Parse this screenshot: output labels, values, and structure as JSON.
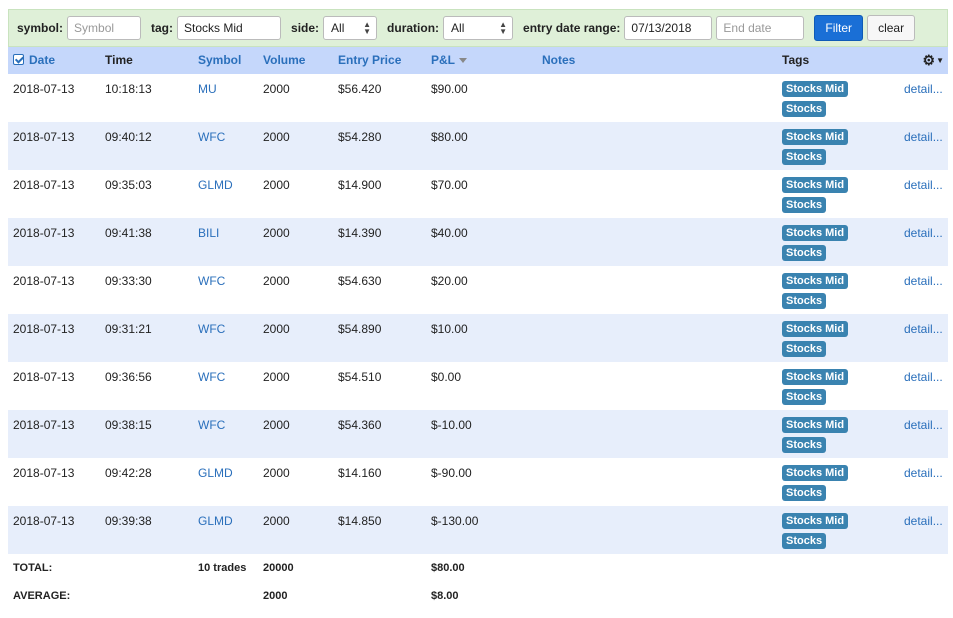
{
  "filters": {
    "symbol_label": "symbol:",
    "symbol_placeholder": "Symbol",
    "tag_label": "tag:",
    "tag_value": "Stocks Mid",
    "side_label": "side:",
    "side_value": "All",
    "duration_label": "duration:",
    "duration_value": "All",
    "entry_date_label": "entry date range:",
    "start_date_value": "07/13/2018",
    "end_date_placeholder": "End date",
    "filter_button": "Filter",
    "clear_button": "clear"
  },
  "columns": {
    "date": "Date",
    "time": "Time",
    "symbol": "Symbol",
    "volume": "Volume",
    "entry_price": "Entry Price",
    "pnl": "P&L",
    "notes": "Notes",
    "tags": "Tags"
  },
  "rows": [
    {
      "date": "2018-07-13",
      "time": "10:18:13",
      "symbol": "MU",
      "volume": "2000",
      "entry_price": "$56.420",
      "pnl": "$90.00",
      "tag1": "Stocks Mid",
      "tag2": "Stocks",
      "detail": "detail..."
    },
    {
      "date": "2018-07-13",
      "time": "09:40:12",
      "symbol": "WFC",
      "volume": "2000",
      "entry_price": "$54.280",
      "pnl": "$80.00",
      "tag1": "Stocks Mid",
      "tag2": "Stocks",
      "detail": "detail..."
    },
    {
      "date": "2018-07-13",
      "time": "09:35:03",
      "symbol": "GLMD",
      "volume": "2000",
      "entry_price": "$14.900",
      "pnl": "$70.00",
      "tag1": "Stocks Mid",
      "tag2": "Stocks",
      "detail": "detail..."
    },
    {
      "date": "2018-07-13",
      "time": "09:41:38",
      "symbol": "BILI",
      "volume": "2000",
      "entry_price": "$14.390",
      "pnl": "$40.00",
      "tag1": "Stocks Mid",
      "tag2": "Stocks",
      "detail": "detail..."
    },
    {
      "date": "2018-07-13",
      "time": "09:33:30",
      "symbol": "WFC",
      "volume": "2000",
      "entry_price": "$54.630",
      "pnl": "$20.00",
      "tag1": "Stocks Mid",
      "tag2": "Stocks",
      "detail": "detail..."
    },
    {
      "date": "2018-07-13",
      "time": "09:31:21",
      "symbol": "WFC",
      "volume": "2000",
      "entry_price": "$54.890",
      "pnl": "$10.00",
      "tag1": "Stocks Mid",
      "tag2": "Stocks",
      "detail": "detail..."
    },
    {
      "date": "2018-07-13",
      "time": "09:36:56",
      "symbol": "WFC",
      "volume": "2000",
      "entry_price": "$54.510",
      "pnl": "$0.00",
      "tag1": "Stocks Mid",
      "tag2": "Stocks",
      "detail": "detail..."
    },
    {
      "date": "2018-07-13",
      "time": "09:38:15",
      "symbol": "WFC",
      "volume": "2000",
      "entry_price": "$54.360",
      "pnl": "$-10.00",
      "tag1": "Stocks Mid",
      "tag2": "Stocks",
      "detail": "detail..."
    },
    {
      "date": "2018-07-13",
      "time": "09:42:28",
      "symbol": "GLMD",
      "volume": "2000",
      "entry_price": "$14.160",
      "pnl": "$-90.00",
      "tag1": "Stocks Mid",
      "tag2": "Stocks",
      "detail": "detail..."
    },
    {
      "date": "2018-07-13",
      "time": "09:39:38",
      "symbol": "GLMD",
      "volume": "2000",
      "entry_price": "$14.850",
      "pnl": "$-130.00",
      "tag1": "Stocks Mid",
      "tag2": "Stocks",
      "detail": "detail..."
    }
  ],
  "totals": {
    "label": "TOTAL:",
    "trades": "10 trades",
    "volume": "20000",
    "pnl": "$80.00"
  },
  "average": {
    "label": "AVERAGE:",
    "volume": "2000",
    "pnl": "$8.00"
  },
  "icons": {
    "select_all": "checkbox-checked-icon",
    "sort": "sort-desc-icon",
    "settings": "gear-icon",
    "settings_caret": "caret-down-icon"
  },
  "colors": {
    "link": "#2a6fbb",
    "header_bg": "#c5d7fb",
    "alt_row_bg": "#e7eefb",
    "filter_bar_bg": "#dff0d8",
    "tag_bg": "#3a83b0",
    "filter_button_bg": "#1a6fd6"
  }
}
